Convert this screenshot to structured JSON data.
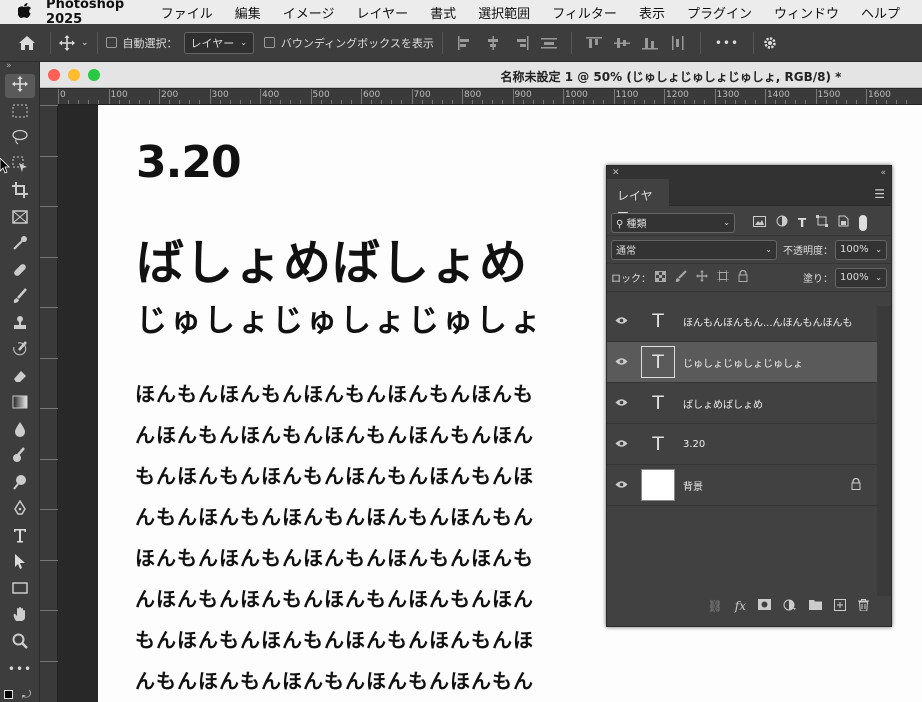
{
  "menubar": {
    "app_name": "Photoshop 2025",
    "items": [
      "ファイル",
      "編集",
      "イメージ",
      "レイヤー",
      "書式",
      "選択範囲",
      "フィルター",
      "表示",
      "プラグイン",
      "ウィンドウ",
      "ヘルプ"
    ]
  },
  "options_bar": {
    "auto_select_label": "自動選択：",
    "auto_select_value": "レイヤー",
    "bounding_box_label": "バウンディングボックスを表示",
    "more_label": "•••"
  },
  "document": {
    "title": "名称未設定 1 @ 50% (じゅしょじゅしょじゅしょ, RGB/8) *",
    "ruler_labels": [
      "0",
      "100",
      "200",
      "300",
      "400",
      "500",
      "600",
      "700",
      "800",
      "900",
      "1000",
      "1100",
      "1200",
      "1300",
      "1400",
      "1500",
      "1600"
    ],
    "canvas_text": {
      "number": "3.20",
      "big": "ばしょめばしょめ",
      "medium": "じゅしょじゅしょじゅしょ",
      "paragraph_lines": [
        "ほんもんほんもんほんもんほんもんほんも",
        "んほんもんほんもんほんもんほんもんほん",
        "もんほんもんほんもんほんもんほんもんほ",
        "んもんほんもんほんもんほんもんほんもん",
        "ほんもんほんもんほんもんほんもんほんも",
        "んほんもんほんもんほんもんほんもんほん",
        "もんほんもんほんもんほんもんほんもんほ",
        "んもんほんもんほんもんほんもんほんもん"
      ]
    }
  },
  "layers_panel": {
    "tab_label": "レイヤー",
    "filter_label": "種類",
    "blend_mode": "通常",
    "opacity_label": "不透明度：",
    "opacity_value": "100%",
    "lock_label": "ロック：",
    "fill_label": "塗り：",
    "fill_value": "100%",
    "layers": [
      {
        "name": "ほんもんほんもん...んほんもんほんも",
        "type": "text",
        "selected": false
      },
      {
        "name": "じゅしょじゅしょじゅしょ",
        "type": "text",
        "selected": true
      },
      {
        "name": "ばしょめばしょめ",
        "type": "text",
        "selected": false
      },
      {
        "name": "3.20",
        "type": "text",
        "selected": false
      },
      {
        "name": "背景",
        "type": "background",
        "locked": true
      }
    ]
  },
  "colors": {
    "panel_bg": "#414141",
    "selected_layer": "#5a5a5a",
    "close": "#fe5f57",
    "minimize": "#febc2e",
    "zoom": "#28c840"
  }
}
